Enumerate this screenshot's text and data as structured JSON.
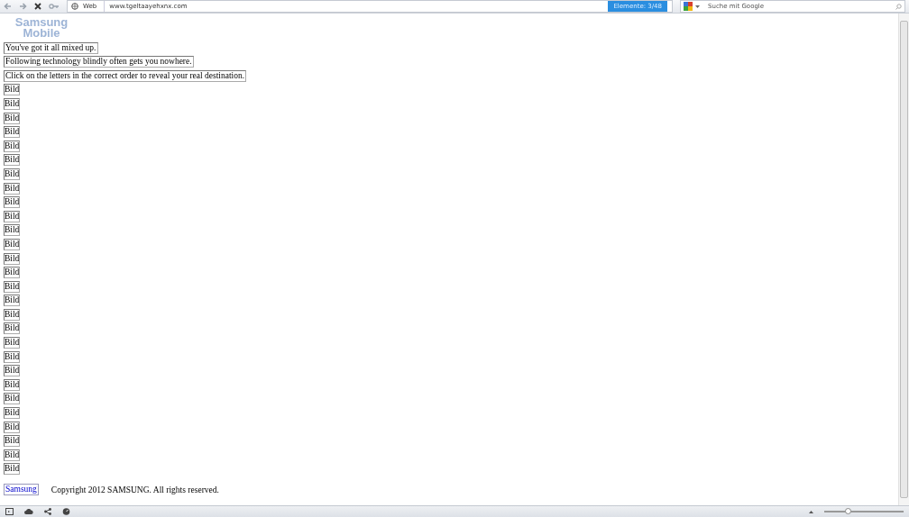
{
  "browser": {
    "address": "www.tgeltaayehxnx.com",
    "site_label": "Web",
    "find_counter": "Elemente: 3/48",
    "search": {
      "placeholder": "Suche mit Google"
    },
    "zoom_slider": {
      "level": 0.3
    }
  },
  "page": {
    "logo": [
      "Samsung",
      "Mobile"
    ],
    "messages": [
      "You've got it all mixed up.",
      "Following technology blindly often gets you nowhere.",
      "Click on the letters in the correct order to reveal your real destination."
    ],
    "images": [
      "Bild",
      "Bild",
      "Bild",
      "Bild",
      "Bild",
      "Bild",
      "Bild",
      "Bild",
      "Bild",
      "Bild",
      "Bild",
      "Bild",
      "Bild",
      "Bild",
      "Bild",
      "Bild",
      "Bild",
      "Bild",
      "Bild",
      "Bild",
      "Bild",
      "Bild",
      "Bild",
      "Bild",
      "Bild",
      "Bild",
      "Bild",
      "Bild"
    ],
    "footer": {
      "link": "Samsung",
      "copyright": "Copyright 2012 SAMSUNG. All rights reserved."
    }
  }
}
